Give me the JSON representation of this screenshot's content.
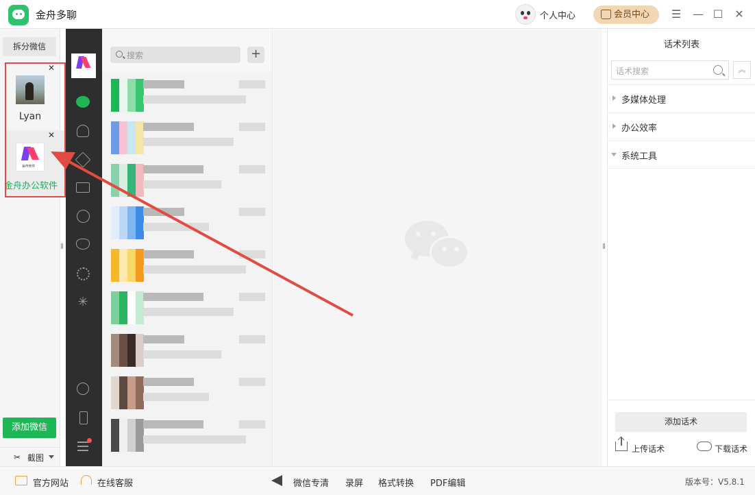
{
  "titlebar": {
    "app_name": "金舟多聊",
    "personal_center": "个人中心",
    "vip_center": "会员中心",
    "menu_glyph": "☰",
    "minimize_glyph": "—",
    "maximize_glyph": "☐",
    "close_glyph": "✕"
  },
  "sidebar": {
    "split_label": "拆分微信",
    "accounts": [
      {
        "name": "Lyan",
        "close": "✕"
      },
      {
        "name": "金舟办公软件",
        "close": "✕",
        "avatar_small_text": "金舟软件"
      }
    ],
    "add_label": "添加微信",
    "screenshot_label": "截图"
  },
  "nav": {
    "icons": [
      "chat-icon",
      "contacts-icon",
      "box-icon",
      "folder-icon",
      "moments-icon",
      "channels-icon",
      "settings-icon",
      "spark-icon",
      "mini-program-icon",
      "phone-icon",
      "menu-icon"
    ],
    "spark_glyph": "✳"
  },
  "conversations": {
    "search_placeholder": "搜索",
    "plus": "+"
  },
  "phrases": {
    "title": "话术列表",
    "search_placeholder": "话术搜索",
    "collapse_glyph": "︽",
    "categories": [
      {
        "label": "多媒体处理",
        "expanded": false
      },
      {
        "label": "办公效率",
        "expanded": false
      },
      {
        "label": "系统工具",
        "expanded": true
      }
    ],
    "add_label": "添加话术",
    "upload_label": "上传话术",
    "download_label": "下载话术"
  },
  "footer": {
    "official_site": "官方网站",
    "online_service": "在线客服",
    "wechat_clear": "微信专清",
    "record_screen": "录屏",
    "format_convert": "格式转换",
    "pdf_edit": "PDF编辑",
    "version": "版本号：V5.8.1"
  },
  "colors": {
    "brand_green": "#1fb655",
    "highlight_red": "#e24b41",
    "vip_gold": "#f1d7b4",
    "dark_nav": "#2e2e2e"
  }
}
